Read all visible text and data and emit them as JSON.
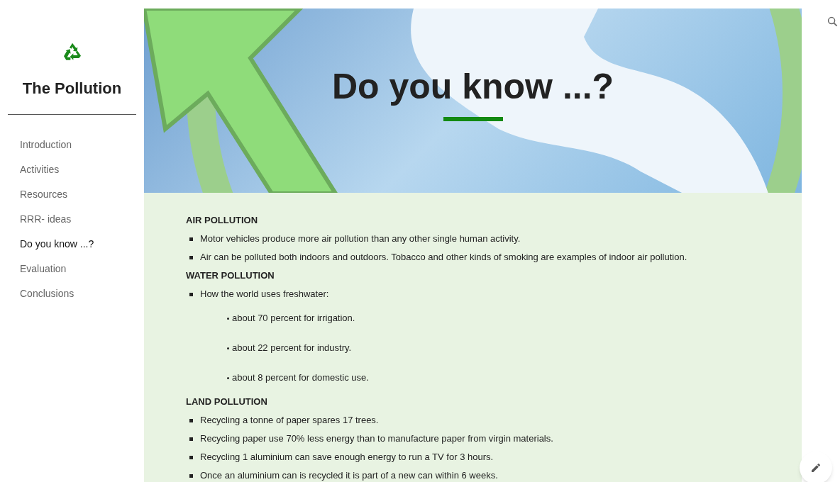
{
  "site": {
    "title": "The Pollution"
  },
  "nav": [
    {
      "label": "Introduction",
      "selected": false
    },
    {
      "label": "Activities",
      "selected": false
    },
    {
      "label": "Resources",
      "selected": false
    },
    {
      "label": "RRR- ideas",
      "selected": false
    },
    {
      "label": "Do you know ...?",
      "selected": true
    },
    {
      "label": "Evaluation",
      "selected": false
    },
    {
      "label": "Conclusions",
      "selected": false
    }
  ],
  "hero": {
    "title": "Do you know ...?"
  },
  "sections": [
    {
      "heading": "AIR POLLUTION",
      "items": [
        {
          "text": "Motor vehicles produce more air pollution than any other single human activity."
        },
        {
          "text": "Air can be polluted both indoors and outdoors. Tobacco and other kinds of smoking are examples of indoor air pollution."
        }
      ]
    },
    {
      "heading": "WATER POLLUTION",
      "items": [
        {
          "text": "How the world uses freshwater:",
          "children": [
            {
              "text": "about 70 percent for irrigation."
            },
            {
              "text": "about 22 percent for industry."
            },
            {
              "text": "about 8 percent for domestic use."
            }
          ]
        }
      ]
    },
    {
      "heading": "LAND POLLUTION",
      "items": [
        {
          "text": "Recycling a tonne of paper spares 17 trees."
        },
        {
          "text": "Recycling paper use 70% less energy than to manufacture paper from virgin materials."
        },
        {
          "text": "Recycling 1 aluminium can save enough energy to run a TV for 3 hours."
        },
        {
          "text": "Once an aluminium can is recycled it is part of a new can within 6 weeks."
        }
      ]
    }
  ]
}
